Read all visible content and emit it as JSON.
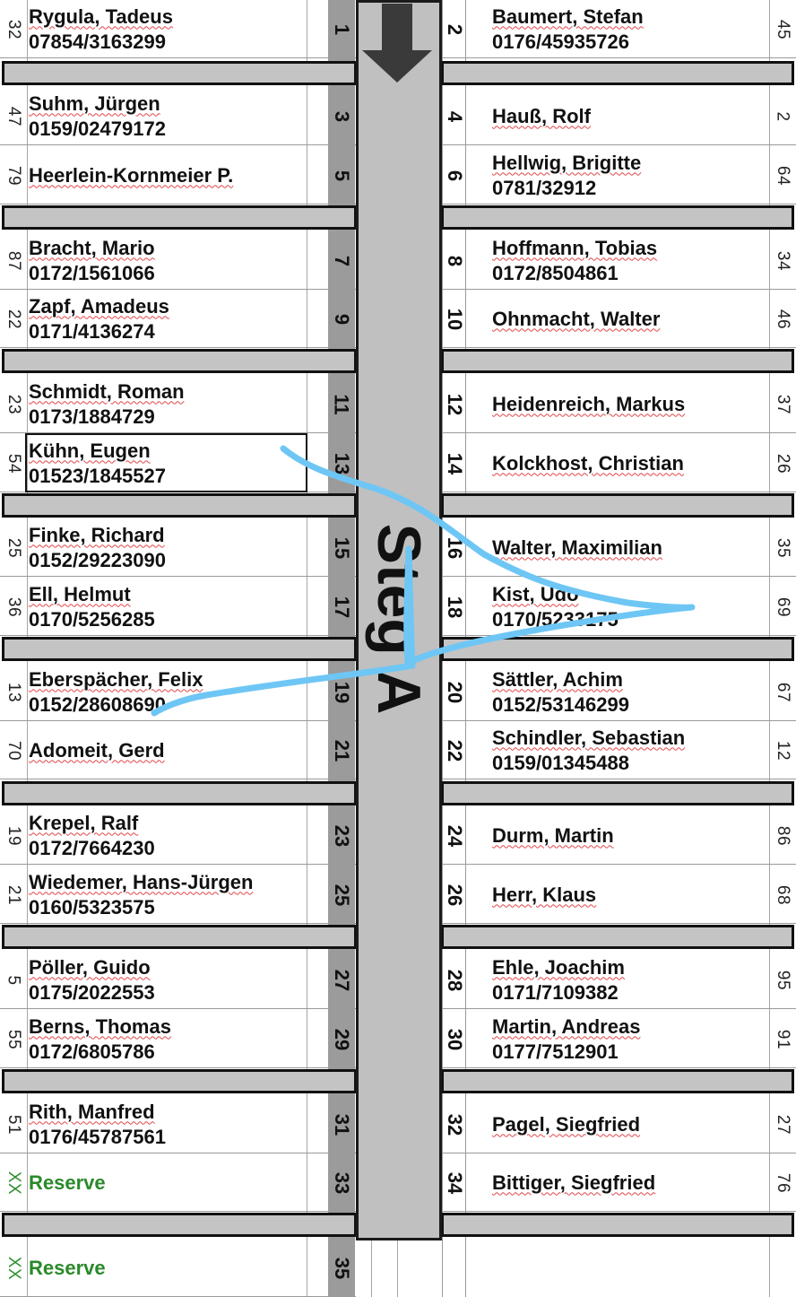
{
  "dock": {
    "title": "Steg A"
  },
  "left_rows": [
    {
      "id": "32",
      "berth": "1",
      "name": "Rygula, Tadeus",
      "phone": "07854/3163299"
    },
    {
      "id": "47",
      "berth": "3",
      "name": "Suhm, Jürgen",
      "phone": "0159/02479172"
    },
    {
      "id": "79",
      "berth": "5",
      "name": "Heerlein-Kornmeier P.",
      "phone": ""
    },
    {
      "id": "87",
      "berth": "7",
      "name": "Bracht, Mario",
      "phone": "0172/1561066"
    },
    {
      "id": "22",
      "berth": "9",
      "name": "Zapf, Amadeus",
      "phone": "0171/4136274"
    },
    {
      "id": "23",
      "berth": "11",
      "name": "Schmidt, Roman",
      "phone": "0173/1884729"
    },
    {
      "id": "54",
      "berth": "13",
      "name": "Kühn, Eugen",
      "phone": "01523/1845527"
    },
    {
      "id": "25",
      "berth": "15",
      "name": "Finke, Richard",
      "phone": "0152/29223090"
    },
    {
      "id": "36",
      "berth": "17",
      "name": "Ell, Helmut",
      "phone": "0170/5256285"
    },
    {
      "id": "13",
      "berth": "19",
      "name": "Eberspächer, Felix",
      "phone": "0152/28608690"
    },
    {
      "id": "70",
      "berth": "21",
      "name": "Adomeit, Gerd",
      "phone": ""
    },
    {
      "id": "19",
      "berth": "23",
      "name": "Krepel, Ralf",
      "phone": "0172/7664230"
    },
    {
      "id": "21",
      "berth": "25",
      "name": "Wiedemer, Hans-Jürgen",
      "phone": "0160/5323575"
    },
    {
      "id": "5",
      "berth": "27",
      "name": "Pöller, Guido",
      "phone": "0175/2022553"
    },
    {
      "id": "55",
      "berth": "29",
      "name": "Berns, Thomas",
      "phone": "0172/6805786"
    },
    {
      "id": "51",
      "berth": "31",
      "name": "Rith, Manfred",
      "phone": "0176/45787561"
    },
    {
      "id": "XX",
      "berth": "33",
      "name": "Reserve",
      "phone": ""
    },
    {
      "id": "XX",
      "berth": "35",
      "name": "Reserve",
      "phone": ""
    }
  ],
  "right_rows": [
    {
      "id": "45",
      "berth": "2",
      "name": "Baumert, Stefan",
      "phone": "0176/45935726"
    },
    {
      "id": "2",
      "berth": "4",
      "name": "Hauß, Rolf",
      "phone": ""
    },
    {
      "id": "64",
      "berth": "6",
      "name": "Hellwig, Brigitte",
      "phone": "0781/32912"
    },
    {
      "id": "34",
      "berth": "8",
      "name": "Hoffmann, Tobias",
      "phone": "0172/8504861"
    },
    {
      "id": "46",
      "berth": "10",
      "name": "Ohnmacht, Walter",
      "phone": ""
    },
    {
      "id": "37",
      "berth": "12",
      "name": "Heidenreich, Markus",
      "phone": ""
    },
    {
      "id": "26",
      "berth": "14",
      "name": "Kolckhost, Christian",
      "phone": ""
    },
    {
      "id": "35",
      "berth": "16",
      "name": "Walter, Maximilian",
      "phone": ""
    },
    {
      "id": "69",
      "berth": "18",
      "name": "Kist, Udo",
      "phone": "0170/5233175"
    },
    {
      "id": "67",
      "berth": "20",
      "name": "Sättler, Achim",
      "phone": "0152/53146299"
    },
    {
      "id": "12",
      "berth": "22",
      "name": "Schindler, Sebastian",
      "phone": "0159/01345488"
    },
    {
      "id": "86",
      "berth": "24",
      "name": "Durm, Martin",
      "phone": ""
    },
    {
      "id": "68",
      "berth": "26",
      "name": "Herr, Klaus",
      "phone": ""
    },
    {
      "id": "95",
      "berth": "28",
      "name": "Ehle, Joachim",
      "phone": "0171/7109382"
    },
    {
      "id": "91",
      "berth": "30",
      "name": "Martin, Andreas",
      "phone": "0177/7512901"
    },
    {
      "id": "27",
      "berth": "32",
      "name": "Pagel, Siegfried",
      "phone": ""
    },
    {
      "id": "76",
      "berth": "34",
      "name": "Bittiger, Siegfried",
      "phone": ""
    }
  ],
  "colors": {
    "dock_fill": "#c0c0c0",
    "left_number_column": "#9b9b9b",
    "reserve_green": "#2a8a2a",
    "annotation_blue": "#6ec6f5",
    "spell_underline": "#e0464a"
  }
}
